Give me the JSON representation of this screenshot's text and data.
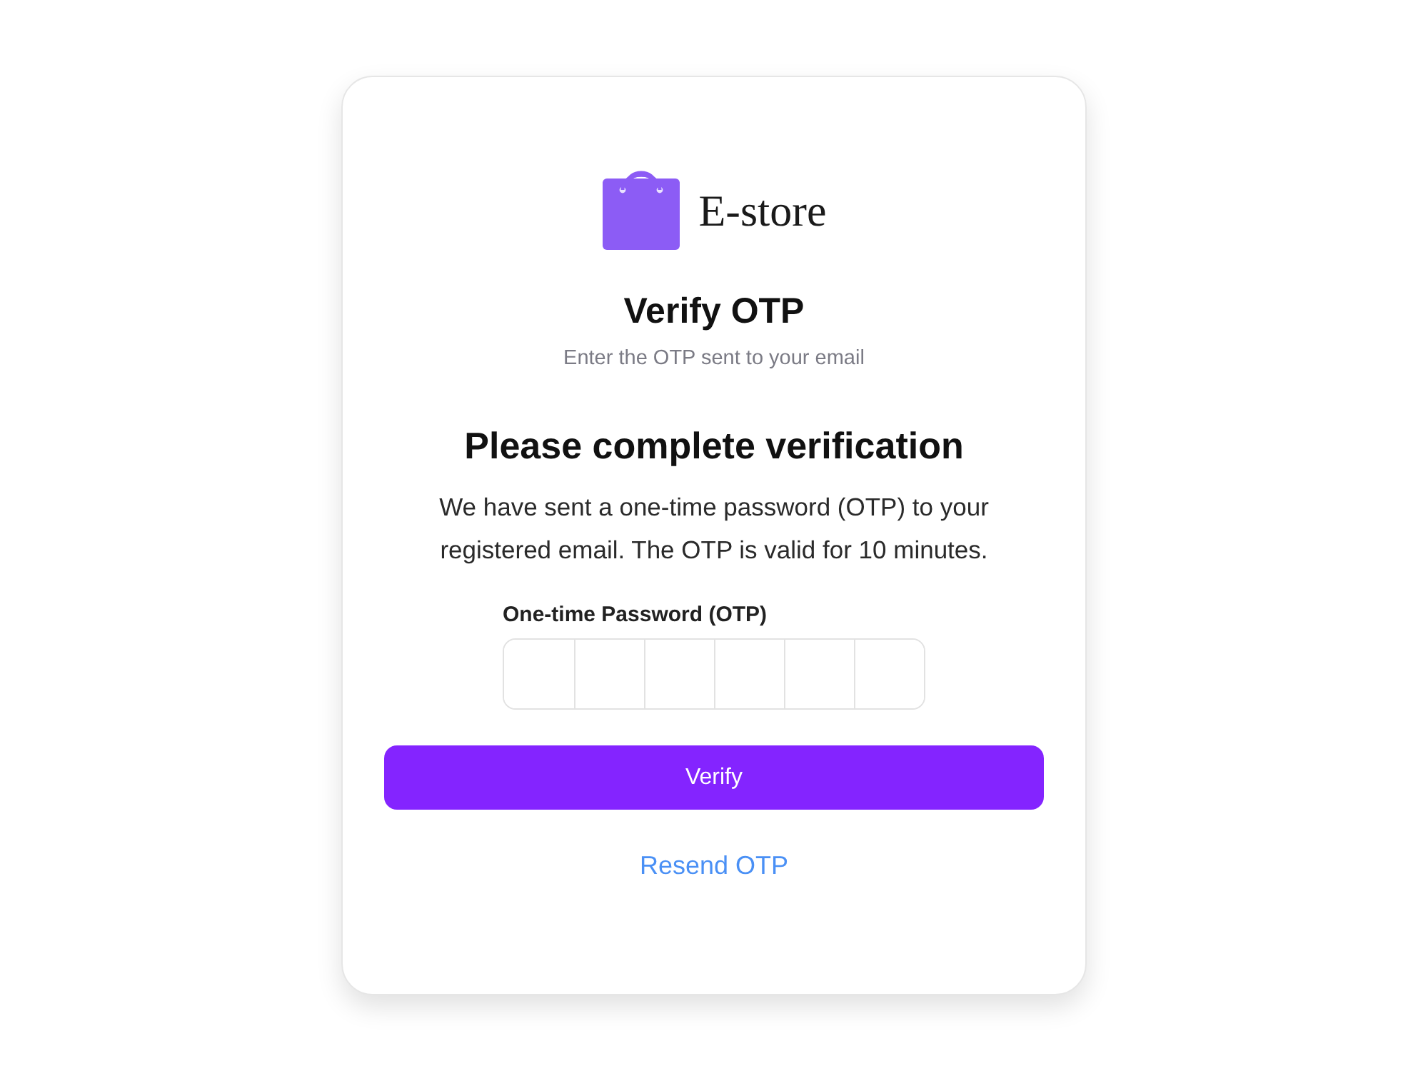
{
  "brand": {
    "name": "E-store"
  },
  "header": {
    "title": "Verify OTP",
    "subtitle": "Enter the OTP sent to your email"
  },
  "verification": {
    "heading": "Please complete verification",
    "message": "We have sent a one-time password (OTP) to your registered email. The OTP is valid for 10 minutes."
  },
  "otp_field": {
    "label": "One-time Password (OTP)",
    "digit_boxes": [
      {
        "focused": false
      },
      {
        "focused": false
      },
      {
        "focused": false
      },
      {
        "focused": false
      },
      {
        "focused": false
      },
      {
        "focused": false
      }
    ]
  },
  "buttons": [
    {
      "kind": "primary",
      "label": "Verify"
    },
    {
      "kind": "link",
      "label": "Resend OTP"
    }
  ]
}
